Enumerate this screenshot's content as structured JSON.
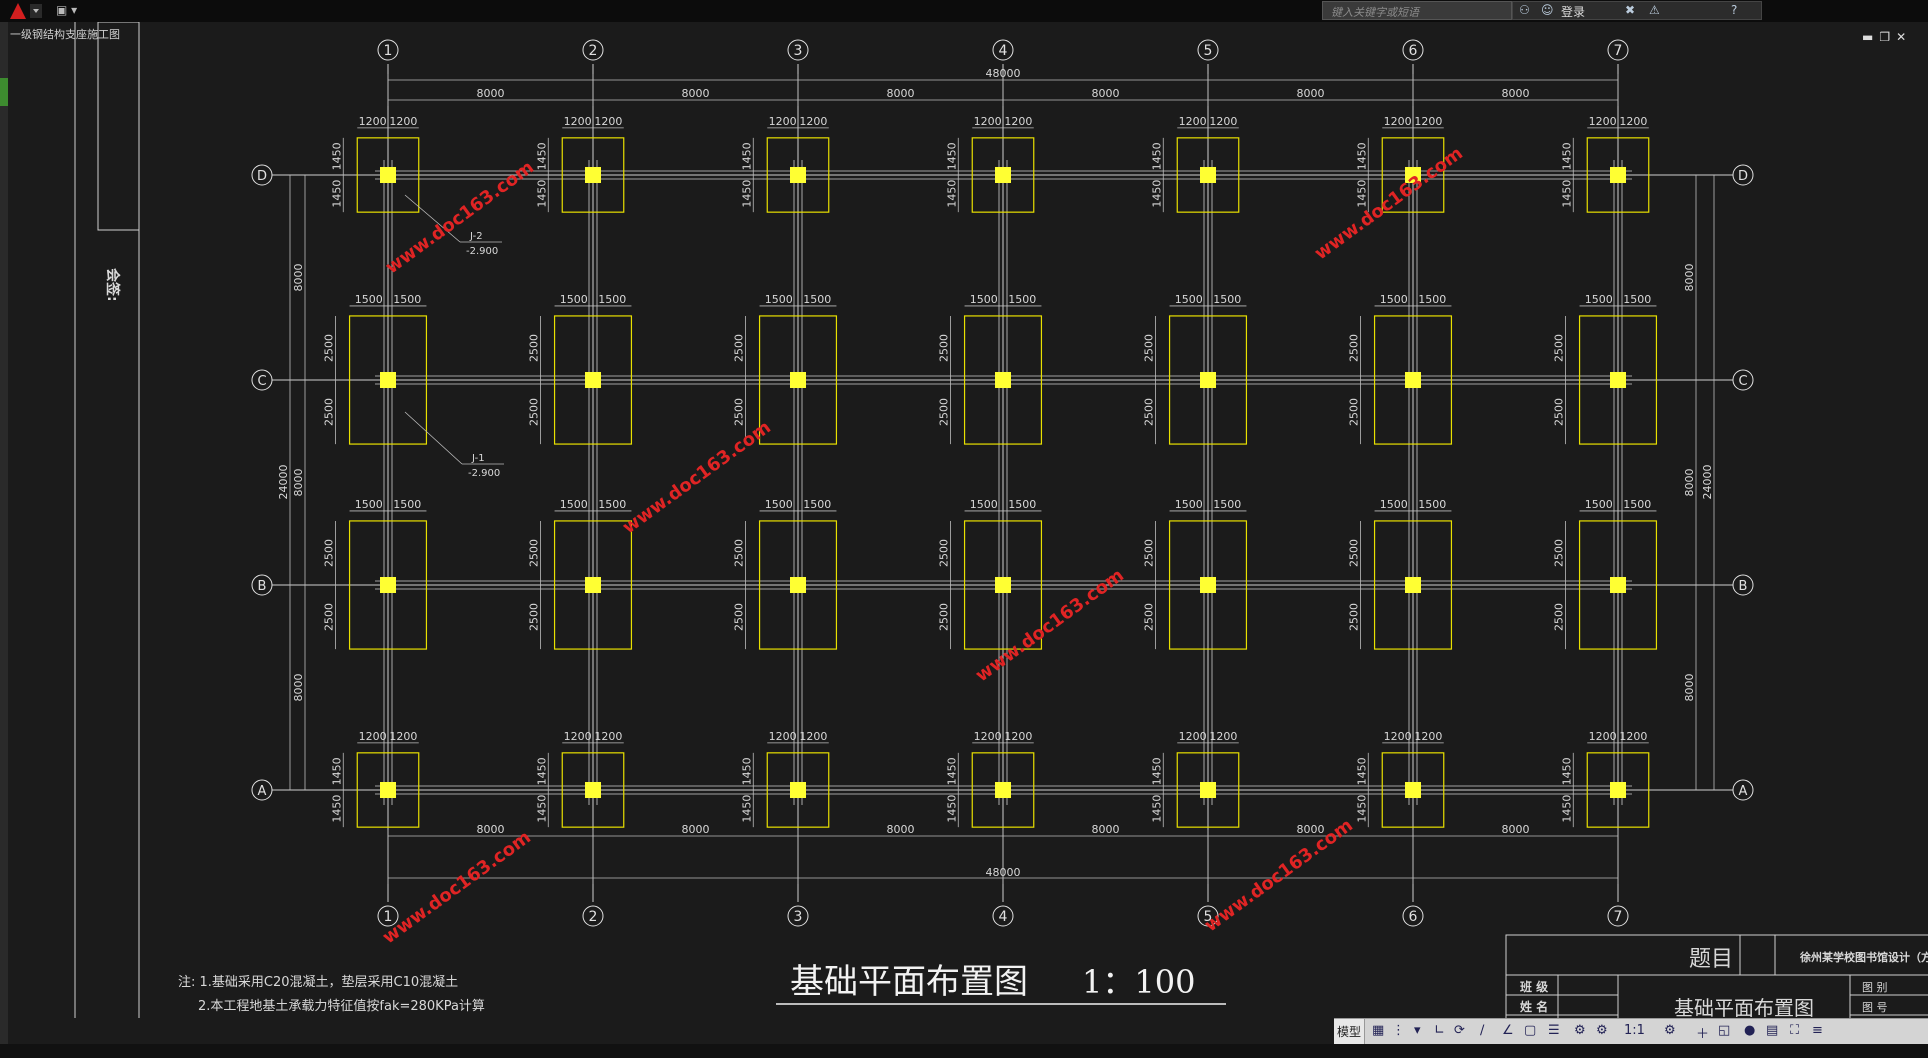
{
  "app": {
    "file_label": "一级钢结构支座施工图",
    "search_placeholder": "键入关键字或短语",
    "login_label": "登录",
    "model_tab": "模型",
    "scale": "1:1"
  },
  "colors": {
    "background": "#1b1b1b",
    "footing": "#e8e000",
    "column": "#ffff33",
    "dimension": "#d8d8d8",
    "watermark": "#e02424"
  },
  "drawing": {
    "title": "基础平面布置图",
    "scale": "1：100",
    "notes": [
      "注: 1.基础采用C20混凝土，垫层采用C10混凝土",
      "2.本工程地基土承载力特征值按fak=280KPa计算"
    ],
    "sign_label": "会签:",
    "watermark": "www.doc163.com",
    "axes_x": [
      "1",
      "2",
      "3",
      "4",
      "5",
      "6",
      "7"
    ],
    "axes_y": [
      "D",
      "C",
      "B",
      "A"
    ],
    "span_x": "8000",
    "total_x": "48000",
    "span_y": "8000",
    "total_y": "24000",
    "dims": {
      "small_half": "1200",
      "large_half": "1500",
      "small_depth": "1450",
      "large_depth": "2500"
    },
    "footing_tags": [
      {
        "name": "J-2",
        "elev": "-2.900"
      },
      {
        "name": "J-1",
        "elev": "-2.900"
      }
    ]
  },
  "title_block": {
    "topic_label": "题目",
    "project": "徐州某学校图书馆设计（方案",
    "drawing_name": "基础平面布置图",
    "class_label": "班 级",
    "name_label": "姓 名",
    "draw_label": "图 别",
    "number_label": "图 号"
  }
}
